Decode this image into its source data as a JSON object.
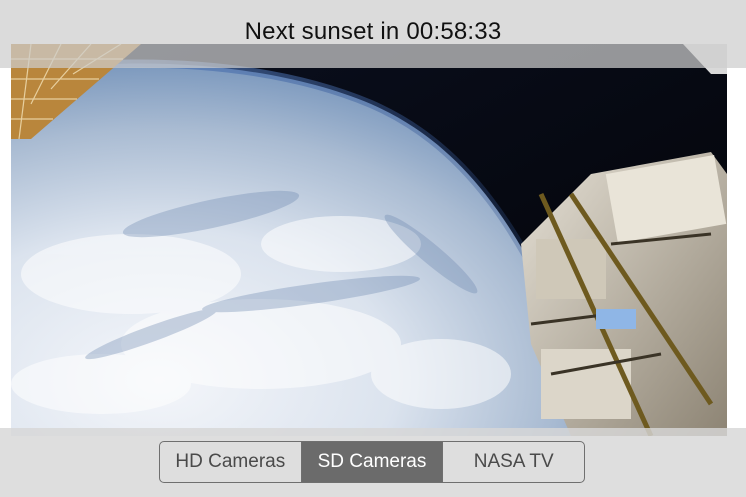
{
  "banner": {
    "sunset_text": "Next sunset in 00:58:33"
  },
  "camera_selector": {
    "segments": [
      {
        "label": "HD Cameras",
        "selected": false
      },
      {
        "label": "SD Cameras",
        "selected": true
      },
      {
        "label": "NASA TV",
        "selected": false
      }
    ]
  },
  "colors": {
    "selected_segment": "#6b6b6b",
    "segment_border": "#6f6f6f"
  }
}
